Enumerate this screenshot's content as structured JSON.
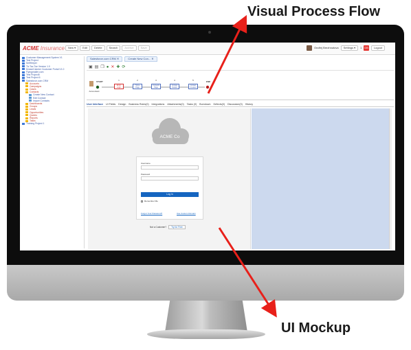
{
  "callouts": {
    "top": "Visual Process Flow",
    "bottom": "UI Mockup"
  },
  "colors": {
    "arrow": "#e8201a",
    "accent": "#1565c0",
    "brand": "#d32f2f",
    "mock_blue": "#ccd9ee"
  },
  "app": {
    "logo_main": "ACME",
    "logo_sub": "Insurance",
    "toolbar": [
      "New ▾",
      "Edit",
      "Delete",
      "Search",
      "Archive",
      "Save"
    ],
    "user_name": "Ondřej Brezhnutova",
    "settings": "Settings ▾",
    "counter": "1",
    "badge": "DB",
    "logout": "Logout"
  },
  "tree": [
    {
      "label": "Customer Management System V1",
      "kind": "proj",
      "indent": 0
    },
    {
      "label": "Test Project",
      "kind": "proj",
      "indent": 0
    },
    {
      "label": "SelfHelper",
      "kind": "proj",
      "indent": 0
    },
    {
      "label": "Tic Tac Toe Version 1.0",
      "kind": "proj",
      "indent": 0
    },
    {
      "label": "DreamCatcher Customer Portal V1.0",
      "kind": "proj",
      "indent": 0
    },
    {
      "label": "Flyingmailer.com",
      "kind": "proj",
      "indent": 0
    },
    {
      "label": "Test Project5",
      "kind": "proj",
      "indent": 0
    },
    {
      "label": "Test Project 6",
      "kind": "proj",
      "indent": 0
    },
    {
      "label": "Salesforce.com CRM",
      "kind": "proj",
      "indent": 0
    },
    {
      "label": "Accounts",
      "kind": "folder",
      "indent": 1
    },
    {
      "label": "Campaigns",
      "kind": "folder",
      "indent": 1
    },
    {
      "label": "Cases",
      "kind": "folder",
      "indent": 1
    },
    {
      "label": "Contacts",
      "kind": "folder",
      "indent": 1
    },
    {
      "label": "Create New Contact",
      "kind": "leaf",
      "indent": 2
    },
    {
      "label": "Edit Contact",
      "kind": "leaf",
      "indent": 2
    },
    {
      "label": "Import Contacts",
      "kind": "leaf",
      "indent": 2
    },
    {
      "label": "Dashboards",
      "kind": "folder",
      "indent": 1
    },
    {
      "label": "Groups",
      "kind": "folder",
      "indent": 1
    },
    {
      "label": "Leads",
      "kind": "folder",
      "indent": 1
    },
    {
      "label": "Opportunities",
      "kind": "folder",
      "indent": 1
    },
    {
      "label": "Quotes",
      "kind": "folder",
      "indent": 1
    },
    {
      "label": "Reports",
      "kind": "folder",
      "indent": 1
    },
    {
      "label": "Tasks",
      "kind": "folder",
      "indent": 1
    },
    {
      "label": "Training Project 1",
      "kind": "proj",
      "indent": 0
    }
  ],
  "tabs": [
    "Salesforce.com CRM ✕",
    "Create New Con... ✕"
  ],
  "flow": {
    "actor": "Accountant",
    "start": "START",
    "end": "END",
    "steps": [
      {
        "num": "1",
        "label": "Enter Login",
        "active": true
      },
      {
        "num": "2",
        "label": "Home Page",
        "active": false
      },
      {
        "num": "3",
        "label": "Contacts Page",
        "active": false
      },
      {
        "num": "4",
        "label": "Contact Details",
        "active": false
      },
      {
        "num": "5",
        "label": "Contact Created",
        "active": false
      }
    ]
  },
  "subtabs": [
    "User Interface",
    "UI Fields",
    "Design",
    "Business Rules(0)",
    "Integrations",
    "Attachments(0)",
    "Tasks (0)",
    "Burndown",
    "Defects(0)",
    "Discussion(0)",
    "History"
  ],
  "mockup": {
    "brand": "ACME Co",
    "username_label": "Username",
    "password_label": "Password",
    "login_button": "Log In",
    "remember": "Remember Me",
    "forgot": "Forgot Your Password?",
    "custom_domain": "Use Custom Domain",
    "not_customer": "Not a Customer?",
    "try_free": "Try for Free"
  }
}
